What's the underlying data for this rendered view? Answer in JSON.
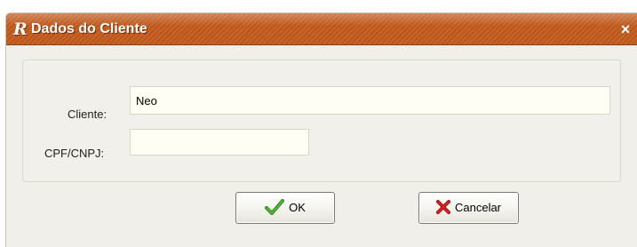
{
  "window": {
    "title": "Dados do Cliente",
    "logo_letter": "R",
    "close_glyph": "×",
    "colors": {
      "titlebar": "#c15e24",
      "body": "#f0efe9"
    }
  },
  "form": {
    "cliente_label": "Cliente:",
    "cliente_value": "Neo",
    "cpf_label": "CPF/CNPJ:",
    "cpf_value": ""
  },
  "buttons": {
    "ok_label": "OK",
    "ok_icon": "checkmark-icon",
    "cancel_label": "Cancelar",
    "cancel_icon": "red-x-icon"
  }
}
